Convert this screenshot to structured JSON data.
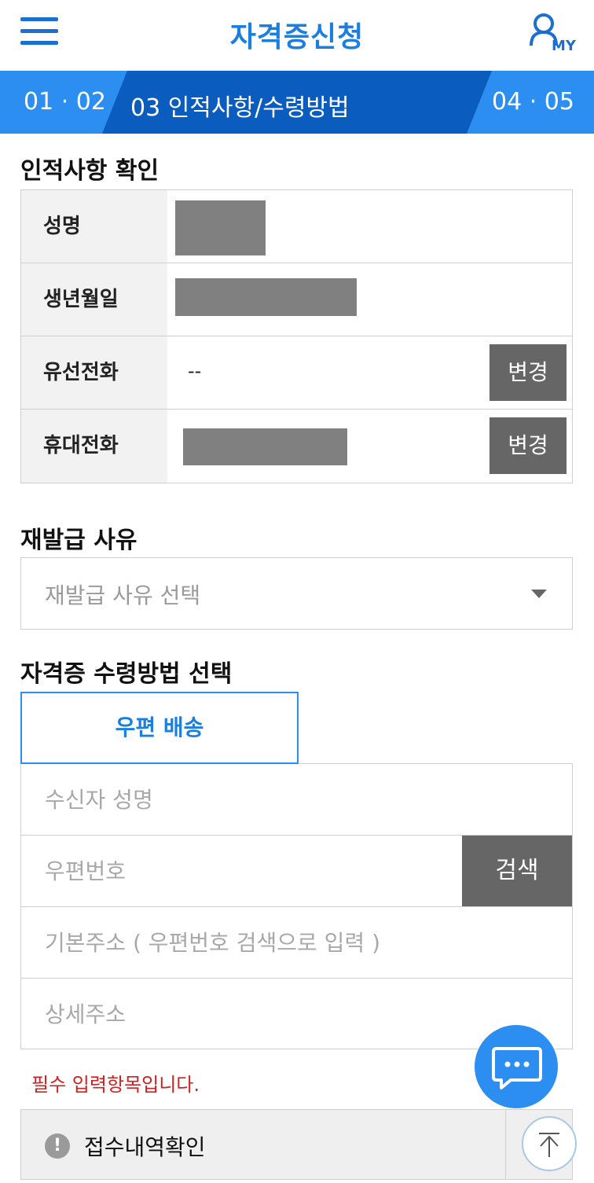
{
  "header": {
    "title": "자격증신청",
    "my_label": "MY"
  },
  "steps": {
    "left": "01 · 02",
    "current": "03  인적사항/수령방법",
    "right": "04 · 05"
  },
  "personal": {
    "title": "인적사항 확인",
    "rows": [
      {
        "label": "성명"
      },
      {
        "label": "생년월일"
      },
      {
        "label": "유선전화",
        "value": "--",
        "button": "변경"
      },
      {
        "label": "휴대전화",
        "button": "변경"
      }
    ]
  },
  "reissue": {
    "title": "재발급 사유",
    "placeholder": "재발급 사유 선택"
  },
  "receive": {
    "title": "자격증 수령방법 선택",
    "tab_label": "우편 배송",
    "recipient_placeholder": "수신자 성명",
    "zip_placeholder": "우편번호",
    "search_label": "검색",
    "base_address_placeholder": "기본주소 ( 우편번호 검색으로 입력 )",
    "detail_address_placeholder": "상세주소"
  },
  "required_message": "필수 입력항목입니다.",
  "history": {
    "alert_glyph": "!",
    "label": "접수내역확인"
  },
  "icons": {
    "menu": "menu-icon",
    "my": "user-icon",
    "chat": "chat-icon",
    "top": "arrow-up-icon"
  },
  "colors": {
    "accent": "#2c8ef0",
    "accent_dark": "#0a5cbf",
    "error": "#d22020",
    "button": "#666666"
  }
}
